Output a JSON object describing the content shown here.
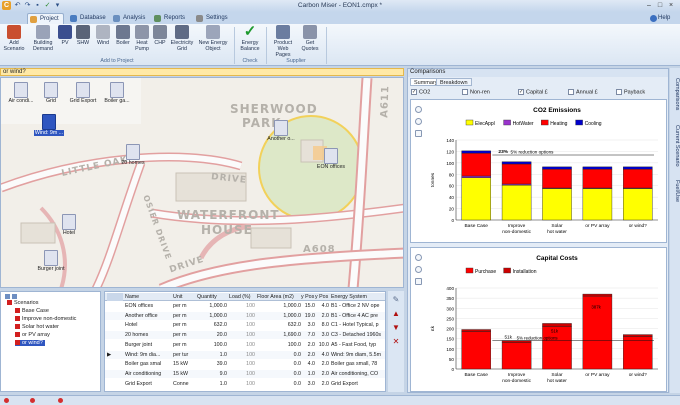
{
  "app": {
    "title": "Carbon Miser - EON1.cmpx *",
    "help_label": "Help"
  },
  "tabs": [
    {
      "label": "Project",
      "active": true
    },
    {
      "label": "Database"
    },
    {
      "label": "Analysis"
    },
    {
      "label": "Reports"
    },
    {
      "label": "Settings"
    }
  ],
  "ribbon": {
    "buttons": [
      {
        "label": "Add Scenario",
        "icon": "add-scenario-icon"
      },
      {
        "label": "Building Demand",
        "icon": "building-icon"
      },
      {
        "label": "PV",
        "icon": "pv-icon"
      },
      {
        "label": "SHW",
        "icon": "shw-icon"
      },
      {
        "label": "Wind",
        "icon": "wind-icon"
      },
      {
        "label": "Boiler",
        "icon": "boiler-icon"
      },
      {
        "label": "Heat Pump",
        "icon": "heat-pump-icon"
      },
      {
        "label": "CHP",
        "icon": "chp-icon"
      },
      {
        "label": "Electricity Grid",
        "icon": "grid-icon"
      },
      {
        "label": "New Energy Object",
        "icon": "energy-object-icon"
      },
      {
        "label": "Energy Balance",
        "icon": "checkmark-icon"
      },
      {
        "label": "Product Web Pages",
        "icon": "web-pages-icon"
      },
      {
        "label": "Get Quotes",
        "icon": "quotes-icon"
      }
    ],
    "groups": {
      "add_to_project": "Add to Project",
      "check": "Check",
      "supplier": "Supplier"
    }
  },
  "search_text": "or wind?",
  "map": {
    "labels": [
      "SHERWOOD",
      "PARK",
      "LITTLE OAK",
      "DRIVE",
      "WATERFRONT",
      "HOUSE",
      "OSIER DRIVE",
      "A611",
      "A608",
      "DRIVE"
    ],
    "nodes": [
      {
        "label": "Air condi..."
      },
      {
        "label": "Grid"
      },
      {
        "label": "Grid Export"
      },
      {
        "label": "Boiler ga..."
      },
      {
        "label": "Wind: 9m ..."
      },
      {
        "label": "20 homes"
      },
      {
        "label": "Another o..."
      },
      {
        "label": "EON offices"
      },
      {
        "label": "Hotel"
      },
      {
        "label": "Burger joint"
      }
    ]
  },
  "tree": {
    "root": "Scenarios",
    "items": [
      "Base Case",
      "Improve non-domestic",
      "Solar hot water",
      "or PV array",
      "or wind?"
    ],
    "selected": "or wind?"
  },
  "grid": {
    "columns": [
      "Name",
      "Unit",
      "Quantity",
      "Load (%)",
      "Floor Area (m2)",
      "y Pos",
      "y Pos",
      "Energy System"
    ],
    "rows": [
      [
        "EON offices",
        "per m",
        "1,000.0",
        "100",
        "1,000.0",
        "15.0",
        "4.0",
        "B1 - Office 2 NV ope"
      ],
      [
        "Another office",
        "per m",
        "1,000.0",
        "100",
        "1,000.0",
        "19.0",
        "2.0",
        "B1 - Office 4 AC pre"
      ],
      [
        "Hotel",
        "per m",
        "632.0",
        "100",
        "632.0",
        "3.0",
        "8.0",
        "C1 - Hotel Typical, p"
      ],
      [
        "20 homes",
        "per m",
        "20.0",
        "100",
        "1,690.0",
        "7.0",
        "3.0",
        "C3 - Detached 1960s"
      ],
      [
        "Burger joint",
        "per m",
        "100.0",
        "100",
        "100.0",
        "2.0",
        "10.0",
        "A5 - Fast Food, typ"
      ],
      [
        "Wind: 9m dia...",
        "per tur",
        "1.0",
        "100",
        "0.0",
        "2.0",
        "4.0",
        "Wind: 9m diam, 5.5m"
      ],
      [
        "Boiler gas smal",
        "15 kW",
        "39.0",
        "100",
        "0.0",
        "4.0",
        "2.0",
        "Boiler gas small, 78"
      ],
      [
        "Air conditioning",
        "15 kW",
        "9.0",
        "100",
        "0.0",
        "1.0",
        "2.0",
        "Air conditioning, CO"
      ],
      [
        "Grid Export",
        "Conne",
        "1.0",
        "100",
        "0.0",
        "3.0",
        "2.0",
        "Grid Export"
      ]
    ]
  },
  "comparisons": {
    "title": "Comparisons",
    "tabs": [
      "Summary",
      "Breakdown"
    ],
    "checks": [
      {
        "label": "CO2",
        "checked": true
      },
      {
        "label": "Non-ren",
        "checked": false
      },
      {
        "label": "Capital £",
        "checked": true
      },
      {
        "label": "Annual £",
        "checked": false
      },
      {
        "label": "Payback",
        "checked": false
      }
    ]
  },
  "side_tabs": [
    "Comparisons",
    "Current Scenario",
    "Fuel/Use"
  ],
  "chart_data": [
    {
      "type": "bar",
      "stacked": true,
      "title": "CO2 Emissions",
      "ylabel": "tonnes",
      "categories": [
        "Base Case",
        "Improve non-domestic",
        "Solar hot water",
        "or PV array",
        "or wind?"
      ],
      "ylim": [
        0,
        140
      ],
      "yticks": [
        0,
        20,
        40,
        60,
        80,
        100,
        120,
        140
      ],
      "series": [
        {
          "name": "ElecAppl",
          "color": "#ffff00",
          "values": [
            74,
            61,
            55,
            55,
            55
          ]
        },
        {
          "name": "HotWater",
          "color": "#9933cc",
          "values": [
            3,
            2,
            1,
            1,
            1
          ]
        },
        {
          "name": "Heating",
          "color": "#ff0000",
          "values": [
            40,
            35,
            33,
            33,
            33
          ]
        },
        {
          "name": "Cooling",
          "color": "#0000cc",
          "values": [
            4,
            4,
            4,
            4,
            4
          ]
        }
      ],
      "annotations": [
        "23%",
        "5% reduction options"
      ],
      "legend": "top"
    },
    {
      "type": "bar",
      "stacked": true,
      "title": "Capital Costs",
      "ylabel": "£k",
      "categories": [
        "Base Case",
        "Improve non-domestic",
        "Solar hot water",
        "or PV array",
        "or wind?"
      ],
      "ylim": [
        0,
        400
      ],
      "yticks": [
        0,
        50,
        100,
        150,
        200,
        250,
        300,
        350,
        400
      ],
      "series": [
        {
          "name": "Purchase",
          "color": "#ff0000",
          "values": [
            185,
            130,
            210,
            360,
            160
          ]
        },
        {
          "name": "Installation",
          "color": "#cc0000",
          "values": [
            10,
            10,
            15,
            10,
            10
          ]
        }
      ],
      "annotations": [
        "51k",
        "5% reduction options",
        "51k",
        "387k"
      ],
      "legend": "top"
    }
  ]
}
